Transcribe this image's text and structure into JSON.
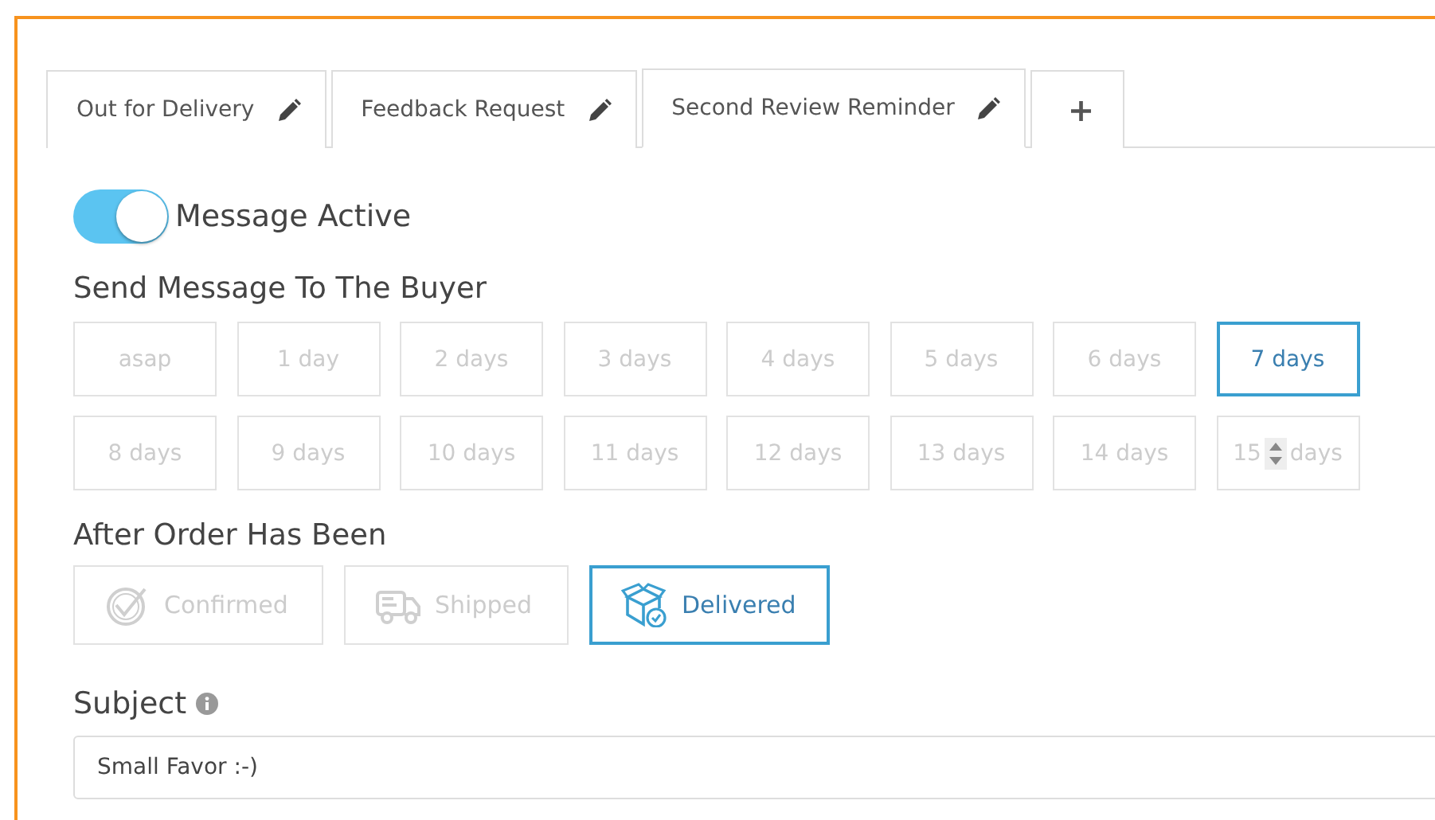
{
  "tabs": [
    {
      "label": "Out for Delivery",
      "selected": false,
      "kind": "message"
    },
    {
      "label": "Feedback Request",
      "selected": false,
      "kind": "message"
    },
    {
      "label": "Second Review Reminder",
      "selected": true,
      "kind": "message"
    },
    {
      "label": "+",
      "selected": false,
      "kind": "add"
    }
  ],
  "active_toggle": {
    "label": "Message Active",
    "on": true
  },
  "send_section": {
    "title": "Send Message To The Buyer",
    "options": [
      {
        "kind": "option",
        "label": "asap",
        "selected": false
      },
      {
        "kind": "option",
        "label": "1 day",
        "selected": false
      },
      {
        "kind": "option",
        "label": "2 days",
        "selected": false
      },
      {
        "kind": "option",
        "label": "3 days",
        "selected": false
      },
      {
        "kind": "option",
        "label": "4 days",
        "selected": false
      },
      {
        "kind": "option",
        "label": "5 days",
        "selected": false
      },
      {
        "kind": "option",
        "label": "6 days",
        "selected": false
      },
      {
        "kind": "option",
        "label": "7 days",
        "selected": true
      },
      {
        "kind": "option",
        "label": "8 days",
        "selected": false
      },
      {
        "kind": "option",
        "label": "9 days",
        "selected": false
      },
      {
        "kind": "option",
        "label": "10 days",
        "selected": false
      },
      {
        "kind": "option",
        "label": "11 days",
        "selected": false
      },
      {
        "kind": "option",
        "label": "12 days",
        "selected": false
      },
      {
        "kind": "option",
        "label": "13 days",
        "selected": false
      },
      {
        "kind": "option",
        "label": "14 days",
        "selected": false
      },
      {
        "kind": "number",
        "value": "15",
        "unit": "days",
        "selected": false
      }
    ]
  },
  "after_section": {
    "title": "After Order Has Been",
    "options": [
      {
        "kind": "confirmed",
        "label": "Confirmed",
        "selected": false
      },
      {
        "kind": "shipped",
        "label": "Shipped",
        "selected": false
      },
      {
        "kind": "delivered",
        "label": "Delivered",
        "selected": true
      }
    ]
  },
  "subject": {
    "label": "Subject",
    "value": "Small Favor :-)"
  }
}
